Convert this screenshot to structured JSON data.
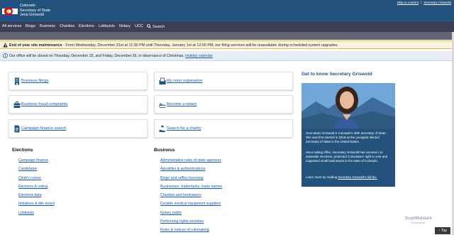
{
  "header": {
    "org_line1": "Colorado",
    "org_line2": "Secretary of State",
    "org_line3": "Jena Griswold",
    "skip_link": "Skip to content",
    "griswold_link": "Secretary Griswold"
  },
  "nav": {
    "items": [
      "All services",
      "Bingo",
      "Business",
      "Charities",
      "Elections",
      "Lobbyists",
      "Notary",
      "UCC"
    ],
    "search_label": "Search"
  },
  "alert": {
    "bold": "End of year site maintenance",
    "text": " - From Wednesday, December 31st at 11:30 PM until Thursday, January 1st at 12:00 PM, our filing services will be unavailable during scheduled system upgrades."
  },
  "notice": {
    "text": "Our office will be closed on Thursday, December 25, and Friday, December 26, in observance of Christmas.",
    "link": "Holiday calendar"
  },
  "cards": [
    {
      "label": "Business filings",
      "icon": "building-icon"
    },
    {
      "label": "My voter registration",
      "icon": "ballot-box-icon"
    },
    {
      "label": "Business fraud complaints",
      "icon": "briefcase-icon"
    },
    {
      "label": "Become a notary",
      "icon": "signature-icon"
    },
    {
      "label": "Campaign finance search",
      "icon": "document-icon"
    },
    {
      "label": "Search for a charity",
      "icon": "charity-hand-icon"
    }
  ],
  "elections": {
    "title": "Elections",
    "links": [
      "Campaign finance",
      "Candidates",
      "Clerk's corner",
      "Elections & voting",
      "Elections data",
      "Initiatives & title board",
      "Lobbyists"
    ]
  },
  "business": {
    "title": "Business",
    "links": [
      "Administrative rules of state agencies",
      "Apostilles & authentications",
      "Bingo and raffles licensing",
      "Businesses, trademarks, trade names",
      "Charities and fundraisers",
      "Durable medical equipment suppliers",
      "Notary public",
      "Performing rights societies",
      "Rules & notices of rulemaking"
    ]
  },
  "sidebar": {
    "title": "Get to know Secretary Griswold",
    "p1": "Jena Marie Griswold is Colorado's 39th Secretary of State. She was first elected in 2018 as the youngest elected Secretary of State in the United States.",
    "p2": "Since taking office, Secretary Griswold has overseen 11 statewide elections, protected Coloradans' right to vote and supported small businesses in the state of Colorado.",
    "p3_prefix": "Learn more by reading ",
    "p3_link": "Secretary Griswold's full bio."
  },
  "watermark": {
    "brand": "ScanMalware",
    "sub": "Screenshot"
  },
  "back_to_top": "Top",
  "colors": {
    "header": "#23527c",
    "nav": "#3e3e55",
    "link": "#1a5aa6",
    "alert_bg": "#fdf4dc"
  }
}
